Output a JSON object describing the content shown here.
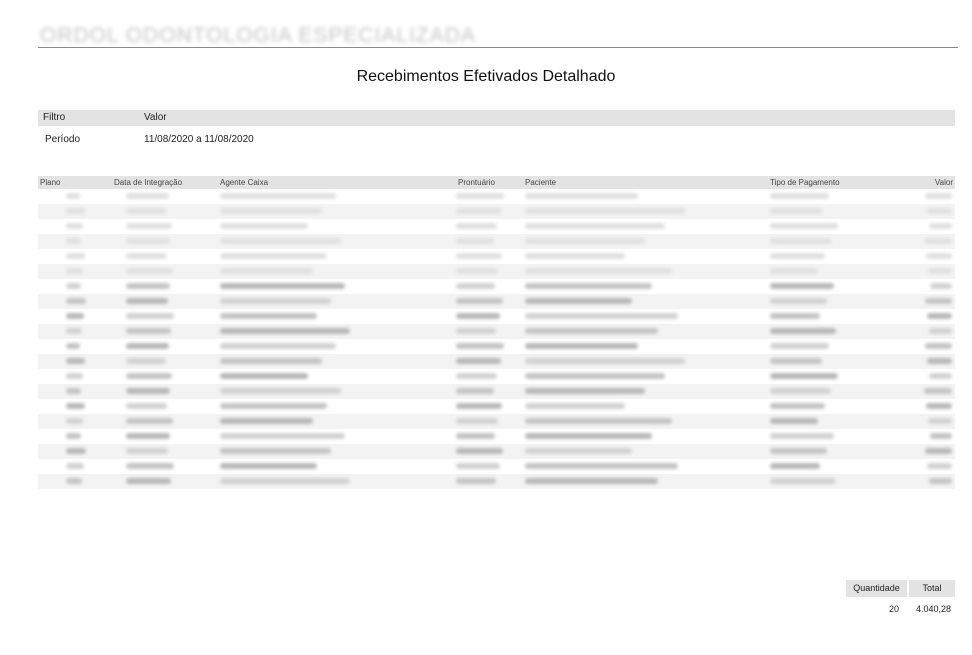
{
  "header": {
    "org_name": "ORDOL ODONTOLOGIA ESPECIALIZADA"
  },
  "report": {
    "title": "Recebimentos Efetivados Detalhado"
  },
  "filter": {
    "col_filter": "Filtro",
    "col_value": "Valor",
    "rows": [
      {
        "name": "Período",
        "value": "11/08/2020 a 11/08/2020"
      }
    ]
  },
  "table": {
    "columns": {
      "plano": "Plano",
      "data_integracao": "Data de Integração",
      "agente_caixa": "Agente Caixa",
      "prontuario": "Prontuário",
      "paciente": "Paciente",
      "tipo_pagamento": "Tipo de Pagamento",
      "valor": "Valor"
    },
    "row_count": 20
  },
  "summary": {
    "quantidade_label": "Quantidade",
    "total_label": "Total",
    "quantidade": "20",
    "total": "4.040,28"
  }
}
